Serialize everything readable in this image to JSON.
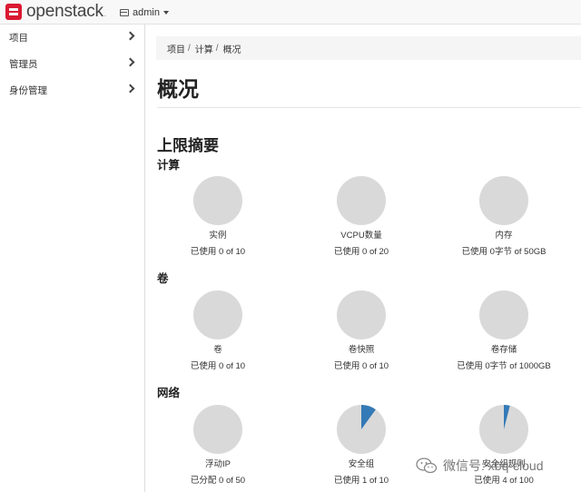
{
  "header": {
    "brand": "openstack",
    "brand_mark": ".",
    "project": "admin"
  },
  "sidebar": {
    "items": [
      {
        "label": "项目"
      },
      {
        "label": "管理员"
      },
      {
        "label": "身份管理"
      }
    ]
  },
  "breadcrumb": [
    "项目",
    "计算",
    "概况"
  ],
  "breadcrumb_sep": "/",
  "page_title": "概况",
  "section_title": "上限摘要",
  "groups": {
    "compute": "计算",
    "volume": "卷",
    "network": "网络"
  },
  "gauges": {
    "instances": {
      "label": "实例",
      "usage": "已使用 0 of 10",
      "fraction": 0
    },
    "vcpus": {
      "label": "VCPU数量",
      "usage": "已使用 0 of 20",
      "fraction": 0
    },
    "ram": {
      "label": "内存",
      "usage": "已使用 0字节 of 50GB",
      "fraction": 0
    },
    "volumes": {
      "label": "卷",
      "usage": "已使用 0 of 10",
      "fraction": 0
    },
    "snapshots": {
      "label": "卷快照",
      "usage": "已使用 0 of 10",
      "fraction": 0
    },
    "storage": {
      "label": "卷存储",
      "usage": "已使用 0字节 of 1000GB",
      "fraction": 0
    },
    "floating_ips": {
      "label": "浮动IP",
      "usage": "已分配 0 of 50",
      "fraction": 0
    },
    "security_groups": {
      "label": "安全组",
      "usage": "已使用 1 of 10",
      "fraction": 0.1
    },
    "security_rules": {
      "label": "安全组规则",
      "usage": "已使用 4 of 100",
      "fraction": 0.04
    }
  },
  "colors": {
    "pie_empty": "#d9d9d9",
    "pie_used": "#337ab7",
    "brand_red": "#da1a32"
  },
  "watermark": {
    "text": "微信号: xbq-cloud",
    "icon": "wechat-icon"
  }
}
